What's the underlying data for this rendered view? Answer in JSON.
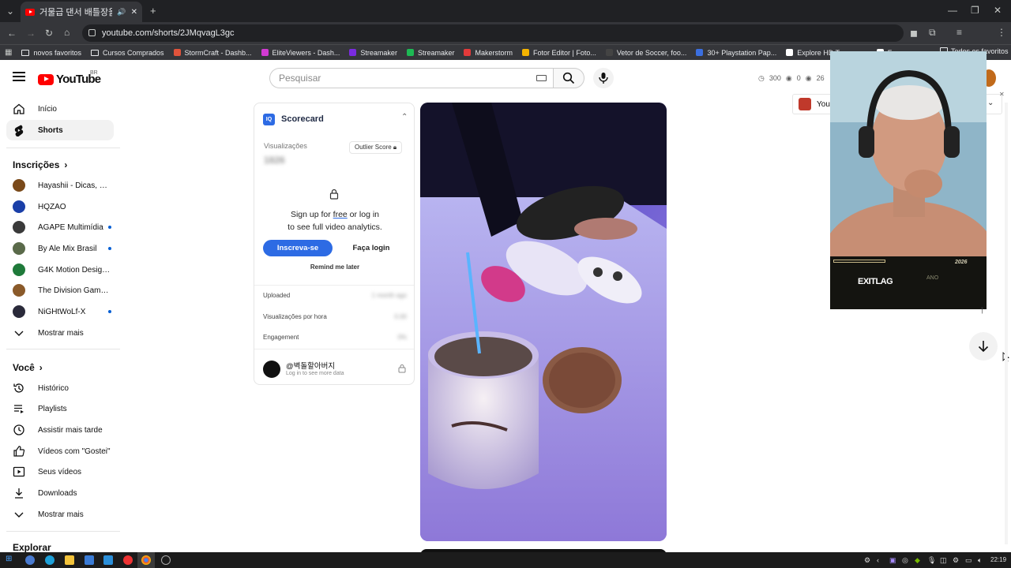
{
  "browser": {
    "tab_title": "거물급 댄서 배틀장을 부시…",
    "url": "youtube.com/shorts/2JMqvagL3gc",
    "bookmarks": [
      {
        "label": "novos favoritos",
        "type": "folder"
      },
      {
        "label": "Cursos Comprados",
        "type": "folder"
      },
      {
        "label": "StormCraft - Dashb...",
        "color": "#e0533b"
      },
      {
        "label": "EliteViewers - Dash...",
        "color": "#d23ad2"
      },
      {
        "label": "Streamaker",
        "color": "#7a2be0"
      },
      {
        "label": "Streamaker",
        "color": "#1db954"
      },
      {
        "label": "Makerstorm",
        "color": "#e23a3a"
      },
      {
        "label": "Fotor Editor | Foto...",
        "color": "#f5b400"
      },
      {
        "label": "Vetor de Soccer, foo...",
        "color": "#444444"
      },
      {
        "label": "30+ Playstation Pap...",
        "color": "#3b6fe0"
      },
      {
        "label": "Explore HD Transpa...",
        "color": "#ffffff"
      },
      {
        "label": "Fu...",
        "color": "#ffffff"
      }
    ],
    "bookmarks_overflow": "Todos os favoritos"
  },
  "masthead": {
    "logo_text": "YouTube",
    "country_code": "BR",
    "search_placeholder": "Pesquisar",
    "stats": [
      "300",
      "0",
      "26"
    ]
  },
  "sidebar": {
    "main": [
      {
        "label": "Início",
        "icon": "home-icon"
      },
      {
        "label": "Shorts",
        "icon": "shorts-icon",
        "active": true
      }
    ],
    "subscriptions_title": "Inscrições",
    "subscriptions": [
      {
        "label": "Hayashii - Dicas, no...",
        "color": "#7a4a1a",
        "new": false
      },
      {
        "label": "HQZAO",
        "color": "#1a3fa8",
        "new": false
      },
      {
        "label": "ÁGAPE Multimídia",
        "color": "#3a3a3a",
        "new": true
      },
      {
        "label": "By Ale Mix Brasil",
        "color": "#5a6a4a",
        "new": true
      },
      {
        "label": "G4K Motion Design...",
        "color": "#1f7a3a",
        "new": false
      },
      {
        "label": "The Division Game ...",
        "color": "#8a5a2a",
        "new": false
      },
      {
        "label": "NiGHtWoLf-X",
        "color": "#2a2a3a",
        "new": true
      }
    ],
    "show_more_1": "Mostrar mais",
    "you_title": "Você",
    "you_items": [
      {
        "label": "Histórico",
        "icon": "history-icon"
      },
      {
        "label": "Playlists",
        "icon": "playlists-icon"
      },
      {
        "label": "Assistir mais tarde",
        "icon": "watch-later-icon"
      },
      {
        "label": "Vídeos com \"Gostei\"",
        "icon": "like-icon"
      },
      {
        "label": "Seus vídeos",
        "icon": "your-videos-icon"
      },
      {
        "label": "Downloads",
        "icon": "download-icon"
      }
    ],
    "show_more_2": "Mostrar mais",
    "explore_title": "Explorar"
  },
  "scorecard": {
    "logo": "IQ",
    "title": "Scorecard",
    "views_label": "Visualizações",
    "views_value": "1826",
    "outlier_label": "Outlier Score",
    "prompt_line1_pre": "Sign up for ",
    "prompt_line1_link": "free",
    "prompt_line1_post": " or log in",
    "prompt_line2": "to see full video analytics.",
    "signup_button": "Inscreva-se",
    "login_button": "Faça login",
    "remind_label": "Remind me later",
    "rows": [
      {
        "label": "Uploaded",
        "value": "1 month ago"
      },
      {
        "label": "Visualizações por hora",
        "value": "0.00"
      },
      {
        "label": "Engagement",
        "value": "0%"
      }
    ],
    "channel_name": "@벽돌할아버지",
    "channel_sub": "Log in to see more data"
  },
  "extension_bar": {
    "label": "You"
  },
  "overlay": {
    "brand": "EXITLAG",
    "tag1": "ANO",
    "tag2": "2026"
  },
  "taskbar": {
    "time": "22:19"
  }
}
